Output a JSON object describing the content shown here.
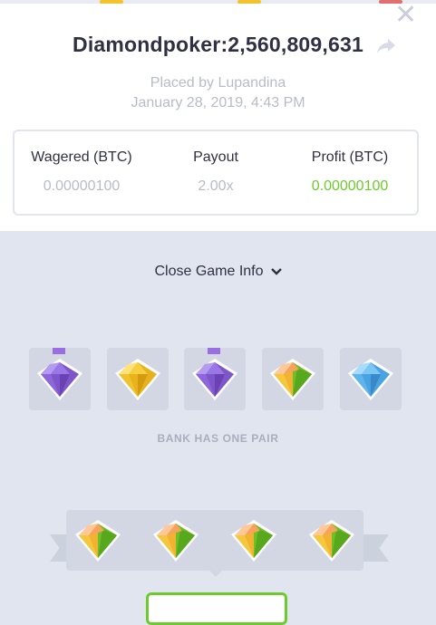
{
  "header": {
    "title": "Diamondpoker:2,560,809,631",
    "placed_by": "Placed by Lupandina",
    "date": "January 28, 2019, 4:43 PM"
  },
  "stats": [
    {
      "label": "Wagered (BTC)",
      "value": "0.00000100"
    },
    {
      "label": "Payout",
      "value": "2.00x"
    },
    {
      "label": "Profit (BTC)",
      "value": "0.00000100"
    }
  ],
  "game_info": {
    "toggle_label": "Close Game Info",
    "bank_result": "BANK HAS ONE PAIR",
    "bank_gems": [
      "purple",
      "yellow",
      "purple",
      "orange-green",
      "blue"
    ],
    "pair_marked": [
      true,
      false,
      true,
      false,
      false
    ],
    "player_gems": [
      "orange-green",
      "orange-green",
      "orange-green",
      "orange-green"
    ]
  },
  "colors": {
    "profit": "#6ccb2c",
    "purple_gem": "#9a6ee0",
    "yellow_gem": "#f2c32c",
    "blue_gem": "#58b4ec",
    "orange_gem": "#f7a35c",
    "green_gem": "#7cc832"
  },
  "icons": {
    "close": "close-icon",
    "share": "share-arrow-icon",
    "chevron": "chevron-down-icon"
  }
}
